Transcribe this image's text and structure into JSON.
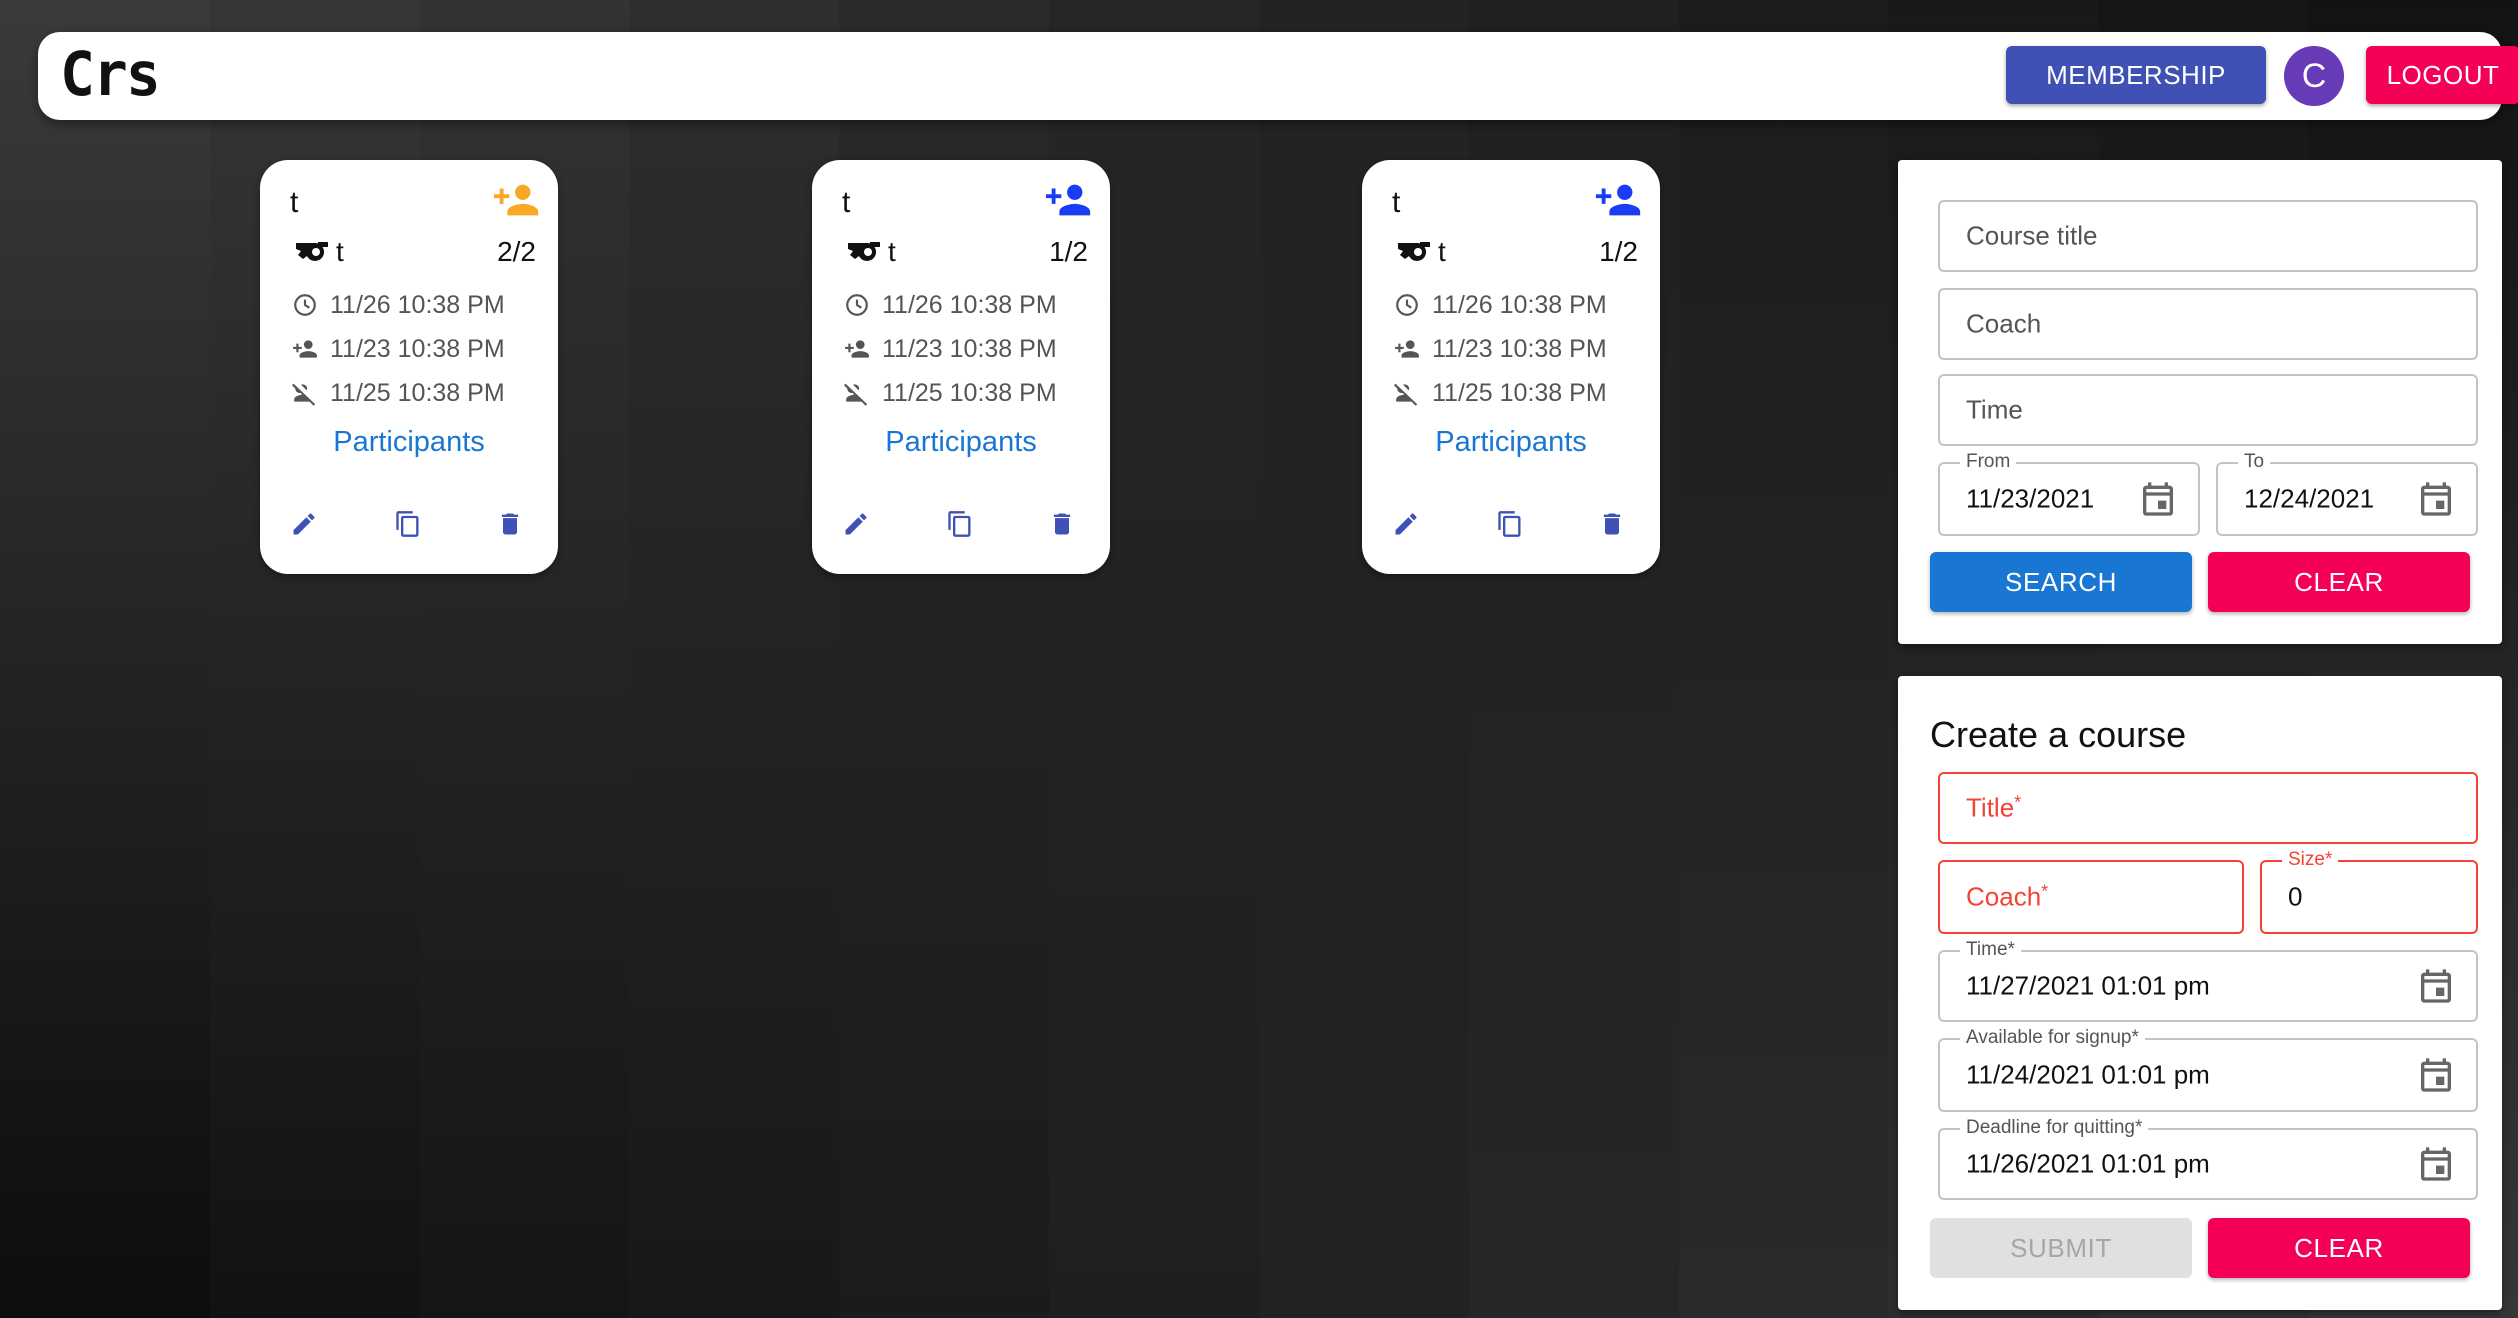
{
  "app": {
    "logo": "Crs"
  },
  "header": {
    "membership_label": "MEMBERSHIP",
    "avatar_letter": "C",
    "logout_label": "LOGOUT"
  },
  "colors": {
    "primary": "#3f51b5",
    "secondary": "#f50057",
    "link": "#1976d2",
    "avatar": "#673ab7",
    "full_icon": "#f9a825",
    "open_icon": "#1a3cf5",
    "error": "#f44336"
  },
  "courses": [
    {
      "title": "t",
      "coach": "t",
      "count": "2/2",
      "time": "11/26 10:38 PM",
      "signup": "11/23 10:38 PM",
      "deadline": "11/25 10:38 PM",
      "participants_label": "Participants",
      "full": true
    },
    {
      "title": "t",
      "coach": "t",
      "count": "1/2",
      "time": "11/26 10:38 PM",
      "signup": "11/23 10:38 PM",
      "deadline": "11/25 10:38 PM",
      "participants_label": "Participants",
      "full": false
    },
    {
      "title": "t",
      "coach": "t",
      "count": "1/2",
      "time": "11/26 10:38 PM",
      "signup": "11/23 10:38 PM",
      "deadline": "11/25 10:38 PM",
      "participants_label": "Participants",
      "full": false
    }
  ],
  "search": {
    "course_title_placeholder": "Course title",
    "coach_placeholder": "Coach",
    "time_placeholder": "Time",
    "from_label": "From",
    "from_value": "11/23/2021",
    "to_label": "To",
    "to_value": "12/24/2021",
    "search_label": "SEARCH",
    "clear_label": "CLEAR"
  },
  "create": {
    "heading": "Create a course",
    "title_placeholder": "Title",
    "coach_placeholder": "Coach",
    "required_mark": "*",
    "size_label": "Size",
    "size_value": "0",
    "time_label": "Time",
    "time_value": "11/27/2021 01:01 pm",
    "signup_label": "Available for signup",
    "signup_value": "11/24/2021 01:01 pm",
    "quit_label": "Deadline for quitting",
    "quit_value": "11/26/2021 01:01 pm",
    "submit_label": "SUBMIT",
    "clear_label": "CLEAR"
  }
}
